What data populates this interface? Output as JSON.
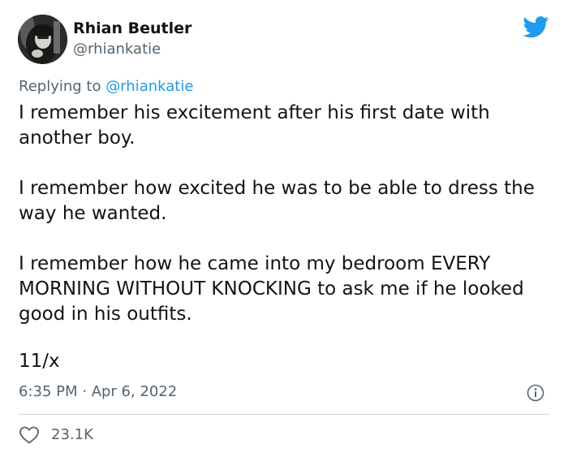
{
  "author": {
    "name": "Rhian Beutler",
    "handle": "@rhiankatie"
  },
  "reply": {
    "prefix": "Replying to ",
    "mention": "@rhiankatie"
  },
  "tweet": {
    "paragraphs": [
      "I remember his excitement after his first date with another boy.",
      "I remember how excited he was to be able to dress the way he wanted.",
      "I remember how he came into my bedroom EVERY MORNING WITHOUT KNOCKING to ask me if he looked good in his outfits."
    ],
    "thread_count": "11/x",
    "timestamp": "6:35 PM · Apr 6, 2022"
  },
  "stats": {
    "likes": "23.1K"
  },
  "icons": {
    "brand": "twitter-bird-icon",
    "info": "info-icon",
    "like": "heart-icon"
  },
  "colors": {
    "brand_blue": "#1d9bf0",
    "secondary_text": "#536471",
    "primary_text": "#0f1419",
    "divider": "#cfd9de"
  }
}
